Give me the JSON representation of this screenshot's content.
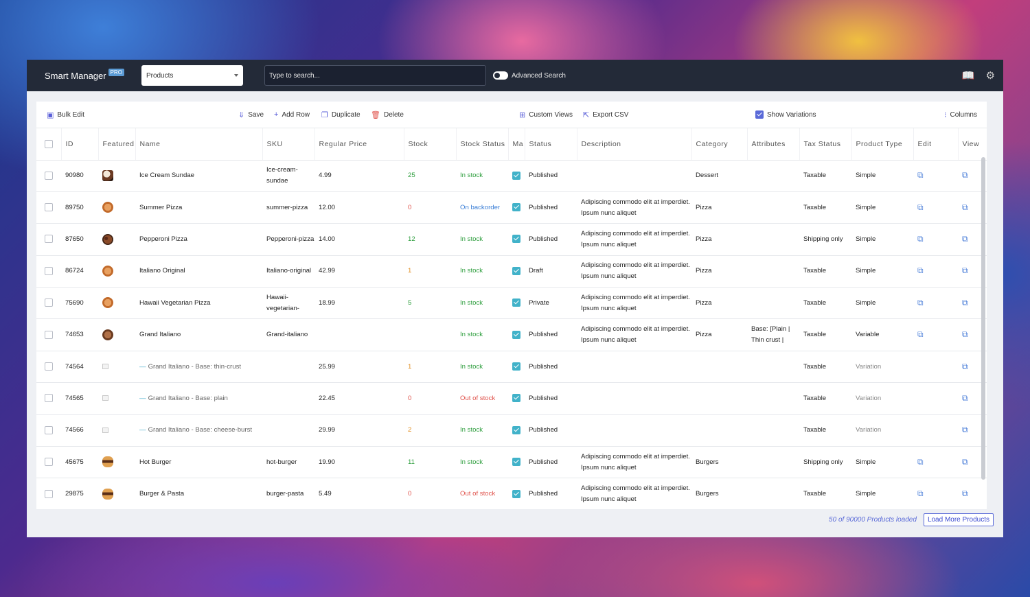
{
  "header": {
    "app_name": "Smart Manager",
    "pro_badge": "PRO",
    "dashboard_select": "Products",
    "search_placeholder": "Type to search...",
    "advanced_search_label": "Advanced Search"
  },
  "toolbar": {
    "bulk_edit": "Bulk Edit",
    "save": "Save",
    "add_row": "Add Row",
    "duplicate": "Duplicate",
    "delete": "Delete",
    "custom_views": "Custom Views",
    "export_csv": "Export CSV",
    "show_variations": "Show Variations",
    "columns": "Columns"
  },
  "columns": [
    "ID",
    "Featured",
    "Name",
    "SKU",
    "Regular Price",
    "Stock",
    "Stock Status",
    "Ma",
    "Status",
    "Description",
    "Category",
    "Attributes",
    "Tax Status",
    "Product Type",
    "Edit",
    "View"
  ],
  "rows": [
    {
      "id": "90980",
      "thumb": "sundae",
      "name": "Ice Cream Sundae",
      "sku": "Ice-cream-sundae",
      "price": "4.99",
      "stock": "25",
      "stock_color": "green",
      "stock_status": "In stock",
      "status_color": "green",
      "status": "Published",
      "description": "",
      "category": "Dessert",
      "attributes": "",
      "tax": "Taxable",
      "type": "Simple",
      "variation": false
    },
    {
      "id": "89750",
      "thumb": "pizza",
      "name": "Summer Pizza",
      "sku": "summer-pizza",
      "price": "12.00",
      "stock": "0",
      "stock_color": "red",
      "stock_status": "On backorder",
      "status_color": "blue",
      "status": "Published",
      "description": "Adipiscing commodo elit at imperdiet. Ipsum nunc aliquet",
      "category": "Pizza",
      "attributes": "",
      "tax": "Taxable",
      "type": "Simple",
      "variation": false
    },
    {
      "id": "87650",
      "thumb": "pepperoni",
      "name": "Pepperoni Pizza",
      "sku": "Pepperoni-pizza",
      "price": "14.00",
      "stock": "12",
      "stock_color": "green",
      "stock_status": "In stock",
      "status_color": "green",
      "status": "Published",
      "description": "Adipiscing commodo elit at imperdiet. Ipsum nunc aliquet",
      "category": "Pizza",
      "attributes": "",
      "tax": "Shipping only",
      "type": "Simple",
      "variation": false
    },
    {
      "id": "86724",
      "thumb": "pizza",
      "name": "Italiano Original",
      "sku": "Italiano-original",
      "price": "42.99",
      "stock": "1",
      "stock_color": "orange",
      "stock_status": "In stock",
      "status_color": "green",
      "status": "Draft",
      "description": "Adipiscing commodo elit at imperdiet. Ipsum nunc aliquet",
      "category": "Pizza",
      "attributes": "",
      "tax": "Taxable",
      "type": "Simple",
      "variation": false
    },
    {
      "id": "75690",
      "thumb": "pizza",
      "name": "Hawaii Vegetarian Pizza",
      "sku": "Hawaii-vegetarian-",
      "price": "18.99",
      "stock": "5",
      "stock_color": "green",
      "stock_status": "In stock",
      "status_color": "green",
      "status": "Private",
      "description": "Adipiscing commodo elit at imperdiet. Ipsum nunc aliquet",
      "category": "Pizza",
      "attributes": "",
      "tax": "Taxable",
      "type": "Simple",
      "variation": false
    },
    {
      "id": "74653",
      "thumb": "grand",
      "name": "Grand Italiano",
      "sku": "Grand-italiano",
      "price": "",
      "stock": "",
      "stock_color": "green",
      "stock_status": "In stock",
      "status_color": "green",
      "status": "Published",
      "description": "Adipiscing commodo elit at imperdiet. Ipsum nunc aliquet",
      "category": "Pizza",
      "attributes": "Base: [Plain | Thin crust |",
      "tax": "Taxable",
      "type": "Variable",
      "variation": false
    },
    {
      "id": "74564",
      "thumb": "placeholder",
      "name": "Grand Italiano - Base: thin-crust",
      "sku": "",
      "price": "25.99",
      "stock": "1",
      "stock_color": "orange",
      "stock_status": "In stock",
      "status_color": "green",
      "status": "Published",
      "description": "",
      "category": "",
      "attributes": "",
      "tax": "Taxable",
      "type": "Variation",
      "variation": true
    },
    {
      "id": "74565",
      "thumb": "placeholder",
      "name": "Grand Italiano - Base: plain",
      "sku": "",
      "price": "22.45",
      "stock": "0",
      "stock_color": "red",
      "stock_status": "Out of stock",
      "status_color": "red",
      "status": "Published",
      "description": "",
      "category": "",
      "attributes": "",
      "tax": "Taxable",
      "type": "Variation",
      "variation": true
    },
    {
      "id": "74566",
      "thumb": "placeholder",
      "name": "Grand Italiano - Base: cheese-burst",
      "sku": "",
      "price": "29.99",
      "stock": "2",
      "stock_color": "orange",
      "stock_status": "In stock",
      "status_color": "green",
      "status": "Published",
      "description": "",
      "category": "",
      "attributes": "",
      "tax": "Taxable",
      "type": "Variation",
      "variation": true
    },
    {
      "id": "45675",
      "thumb": "burger",
      "name": "Hot Burger",
      "sku": "hot-burger",
      "price": "19.90",
      "stock": "11",
      "stock_color": "green",
      "stock_status": "In stock",
      "status_color": "green",
      "status": "Published",
      "description": "Adipiscing commodo elit at imperdiet. Ipsum nunc aliquet",
      "category": "Burgers",
      "attributes": "",
      "tax": "Shipping only",
      "type": "Simple",
      "variation": false
    },
    {
      "id": "29875",
      "thumb": "burger",
      "name": "Burger & Pasta",
      "sku": "burger-pasta",
      "price": "5.49",
      "stock": "0",
      "stock_color": "red",
      "stock_status": "Out of stock",
      "status_color": "red",
      "status": "Published",
      "description": "Adipiscing commodo elit at imperdiet. Ipsum nunc aliquet",
      "category": "Burgers",
      "attributes": "",
      "tax": "Taxable",
      "type": "Simple",
      "variation": false
    }
  ],
  "footer": {
    "loaded_text": "50 of 90000 Products loaded",
    "load_more": "Load More Products"
  },
  "colors": {
    "topbar": "#232a38",
    "accent": "#5a6ad8",
    "in_stock": "#2e9e3e",
    "out_of_stock": "#e0524b",
    "backorder": "#3a7ed6",
    "checkbox": "#41b2c9"
  },
  "icons": {
    "docs": "book-icon",
    "settings": "gear-icon",
    "edit": "external-link-icon",
    "view": "external-link-icon"
  }
}
